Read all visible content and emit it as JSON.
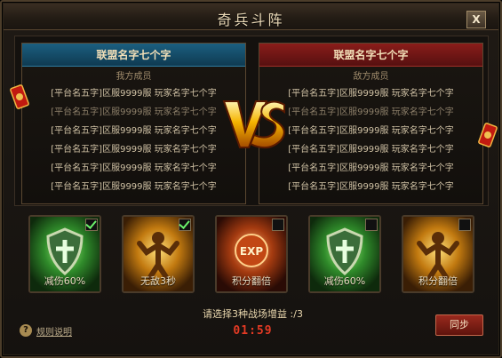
{
  "window": {
    "title": "奇兵斗阵",
    "close_label": "X"
  },
  "ours": {
    "name": "联盟名字七个字",
    "subtitle": "我方成员",
    "members": [
      "[平台名五字]区服9999服 玩家名字七个字",
      "[平台名五字]区服9999服 玩家名字七个字",
      "[平台名五字]区服9999服 玩家名字七个字",
      "[平台名五字]区服9999服 玩家名字七个字",
      "[平台名五字]区服9999服 玩家名字七个字",
      "[平台名五字]区服9999服 玩家名字七个字"
    ]
  },
  "enemy": {
    "name": "联盟名字七个字",
    "subtitle": "敌方成员",
    "members": [
      "[平台名五字]区服9999服 玩家名字七个字",
      "[平台名五字]区服9999服 玩家名字七个字",
      "[平台名五字]区服9999服 玩家名字七个字",
      "[平台名五字]区服9999服 玩家名字七个字",
      "[平台名五字]区服9999服 玩家名字七个字",
      "[平台名五字]区服9999服 玩家名字七个字"
    ]
  },
  "buffs": [
    {
      "label": "减伤60%",
      "icon": "shield-icon",
      "checked": true
    },
    {
      "label": "无敌3秒",
      "icon": "golden-warrior-icon",
      "checked": true
    },
    {
      "label": "积分翻倍",
      "icon": "exp-orb-icon",
      "checked": false
    },
    {
      "label": "减伤60%",
      "icon": "shield-icon",
      "checked": false
    },
    {
      "label": "积分翻倍",
      "icon": "golden-warrior-icon",
      "checked": false
    }
  ],
  "footer": {
    "prompt": "请选择3种战场增益",
    "count": ":/3",
    "timer": "01:59",
    "help_label": "规则说明",
    "sync_label": "同步"
  },
  "colors": {
    "ours": "#1b5f80",
    "enemy": "#8a1d1a",
    "timer": "#e43a24",
    "check": "#6bf36b"
  }
}
